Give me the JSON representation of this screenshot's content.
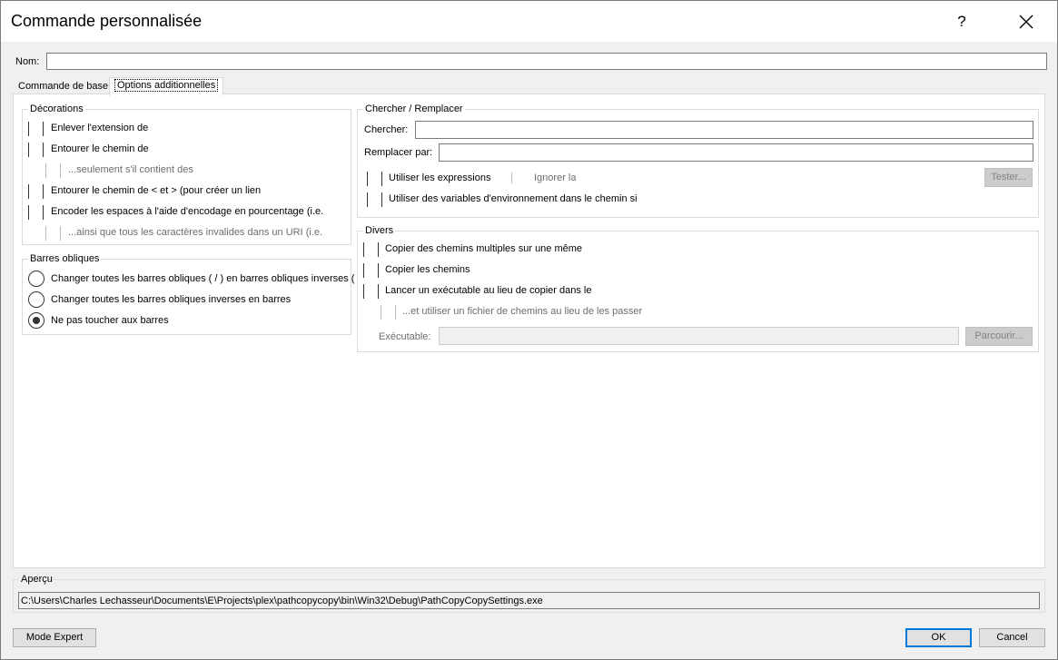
{
  "window": {
    "title": "Commande personnalisée",
    "help_label": "?"
  },
  "name_field": {
    "label": "Nom:",
    "value": ""
  },
  "tabs": [
    {
      "label": "Commande de base",
      "selected": false
    },
    {
      "label": "Options additionnelles",
      "selected": true
    }
  ],
  "decorations": {
    "title": "Décorations",
    "items": [
      "Enlever l'extension de",
      "Entourer le chemin de",
      "...seulement s'il contient des",
      "Entourer le chemin de < et > (pour créer un lien",
      "Encoder les espaces à l'aide d'encodage en pourcentage (i.e.",
      "...ainsi que tous les caractères invalides dans un URI (i.e."
    ]
  },
  "slashes": {
    "title": "Barres obliques",
    "options": [
      "Changer toutes les barres obliques ( / ) en barres obliques inverses (",
      "Changer toutes les barres obliques inverses en barres",
      "Ne pas toucher aux barres"
    ],
    "selected_index": 2
  },
  "search_replace": {
    "title": "Chercher / Remplacer",
    "search_label": "Chercher:",
    "search_value": "",
    "replace_label": "Remplacer par:",
    "replace_value": "",
    "use_regex_label": "Utiliser les expressions",
    "ignore_case_label": "Ignorer la",
    "test_button": "Tester...",
    "env_vars_label": "Utiliser des variables d'environnement dans le chemin si"
  },
  "misc": {
    "title": "Divers",
    "items": [
      "Copier des chemins multiples sur une même",
      "Copier les chemins",
      "Lancer un exécutable au lieu de copier dans le",
      "...et utiliser un fichier de chemins au lieu de les passer"
    ],
    "executable_label": "Exécutable:",
    "executable_value": "",
    "browse_button": "Parcourir..."
  },
  "preview": {
    "title": "Aperçu",
    "value": "C:\\Users\\Charles Lechasseur\\Documents\\E\\Projects\\plex\\pathcopycopy\\bin\\Win32\\Debug\\PathCopyCopySettings.exe"
  },
  "buttons": {
    "expert": "Mode Expert",
    "ok": "OK",
    "cancel": "Cancel"
  },
  "icons": {
    "close": "close-icon"
  }
}
